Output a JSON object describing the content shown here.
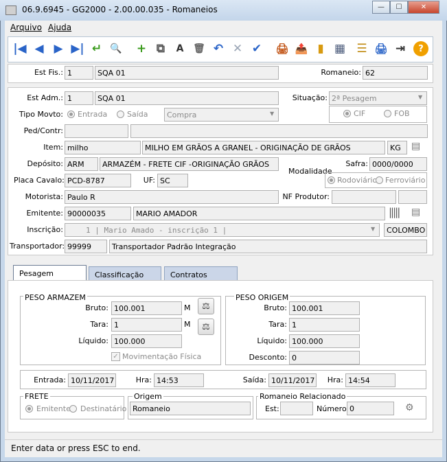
{
  "window": {
    "title": "06.9.6945 - GG2000 - 2.00.00.035 - Romaneios",
    "min": "—",
    "max": "☐",
    "close": "✕"
  },
  "menu": {
    "arquivo": "Arquivo",
    "ajuda": "Ajuda"
  },
  "toolbar": {
    "first": "|◀",
    "prev": "◀",
    "next": "▶",
    "last": "▶|",
    "enter": "↵",
    "view": "🔍",
    "new": "+",
    "copy": "⧉",
    "text": "A",
    "delete": "🗑",
    "undo": "↶",
    "cancel": "✕",
    "confirm": "✔",
    "print_user": "🖨",
    "export": "📤",
    "book": "▮",
    "calc": "▦",
    "tree": "☰",
    "print": "🖨",
    "exit": "⇥",
    "help": "?"
  },
  "header": {
    "est_fis_label": "Est Fis.:",
    "est_fis_code": "1",
    "est_fis_name": "SQA 01",
    "romaneio_label": "Romaneio:",
    "romaneio": "62"
  },
  "form": {
    "est_adm_label": "Est Adm.:",
    "est_adm_code": "1",
    "est_adm_name": "SQA 01",
    "situacao_label": "Situação:",
    "situacao": "2ª Pesagem",
    "tipo_movto_label": "Tipo Movto:",
    "entrada": "Entrada",
    "saida": "Saída",
    "compra": "Compra",
    "cif": "CIF",
    "fob": "FOB",
    "ped_contr_label": "Ped/Contr:",
    "item_label": "Item:",
    "item_code": "milho",
    "item_desc": "MILHO EM GRÃOS A GRANEL - ORIGINAÇÃO DE GRÃOS",
    "item_unit": "KG",
    "deposito_label": "Depósito:",
    "deposito_code": "ARM",
    "deposito_desc": "ARMAZÉM - FRETE CIF -ORIGINAÇÃO GRÃOS",
    "safra_label": "Safra:",
    "safra": "0000/0000",
    "placa_label": "Placa Cavalo:",
    "placa": "PCD-8787",
    "uf_label": "UF:",
    "uf": "SC",
    "modalidade_label": "Modalidade",
    "rodoviario": "Rodoviário",
    "ferroviario": "Ferroviário",
    "motorista_label": "Motorista:",
    "motorista": "Paulo R",
    "nf_label": "NF Produtor:",
    "emitente_label": "Emitente:",
    "emitente_code": "90000035",
    "emitente_name": "MARIO AMADOR",
    "inscricao_label": "Inscrição:",
    "inscricao": "1 | Mario Amado - inscrição 1 |",
    "cidade": "COLOMBO",
    "transp_label": "Transportador:",
    "transp_code": "99999",
    "transp_name": "Transportador Padrão Integração"
  },
  "tabs": [
    "Pesagem",
    "Classificação",
    "Contratos"
  ],
  "peso_armazem": {
    "title": "PESO ARMAZEM",
    "bruto_label": "Bruto:",
    "bruto": "100.001",
    "tara_label": "Tara:",
    "tara": "1",
    "liquido_label": "Líquido:",
    "liquido": "100.000",
    "m": "M",
    "mov_fisica": "Movimentação Física"
  },
  "peso_origem": {
    "title": "PESO ORIGEM",
    "bruto_label": "Bruto:",
    "bruto": "100.001",
    "tara_label": "Tara:",
    "tara": "1",
    "liquido_label": "Líquido:",
    "liquido": "100.000",
    "desconto_label": "Desconto:",
    "desconto": "0"
  },
  "datas": {
    "entrada_label": "Entrada:",
    "entrada": "10/11/2017",
    "hra1_label": "Hra:",
    "hra1": "14:53",
    "saida_label": "Saída:",
    "saida": "10/11/2017",
    "hra2_label": "Hra:",
    "hra2": "14:54"
  },
  "frete": {
    "title": "FRETE",
    "emitente": "Emitente",
    "destinatario": "Destinatário"
  },
  "origem": {
    "title": "Origem",
    "value": "Romaneio"
  },
  "rel": {
    "title": "Romaneio Relacionado",
    "est_label": "Est:",
    "numero_label": "Número:",
    "numero": "0"
  },
  "status": "Enter data or press ESC to end."
}
